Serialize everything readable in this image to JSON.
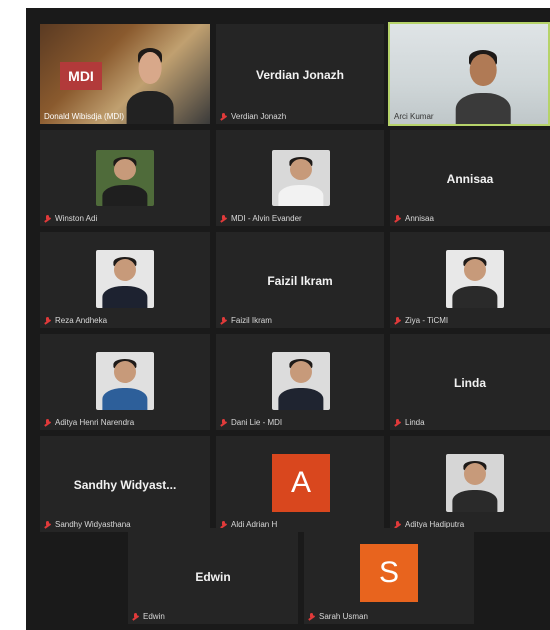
{
  "participants": [
    {
      "label": "Donald Wibisdja (MDI)",
      "kind": "video"
    },
    {
      "label": "Verdian Jonazh",
      "name_card": "Verdian Jonazh",
      "kind": "name"
    },
    {
      "label": "Arci Kumar",
      "kind": "video",
      "active_speaker": true
    },
    {
      "label": "Winston Adi",
      "kind": "photo"
    },
    {
      "label": "MDI - Alvin Evander",
      "kind": "photo"
    },
    {
      "label": "Annisaa",
      "name_card": "Annisaa",
      "kind": "name"
    },
    {
      "label": "Reza Andheka",
      "kind": "photo"
    },
    {
      "label": "Faizil Ikram",
      "name_card": "Faizil Ikram",
      "kind": "name"
    },
    {
      "label": "Ziya - TiCMI",
      "kind": "photo"
    },
    {
      "label": "Aditya Henri Narendra",
      "kind": "photo"
    },
    {
      "label": "Dani Lie - MDI",
      "kind": "photo"
    },
    {
      "label": "Linda",
      "name_card": "Linda",
      "kind": "name"
    },
    {
      "label": "Sandhy Widyasthana",
      "name_card": "Sandhy Widyast...",
      "kind": "name"
    },
    {
      "label": "Aldi Adrian H",
      "avatar_letter": "A",
      "avatar_color": "#d9471e",
      "kind": "letter"
    },
    {
      "label": "Aditya Hadiputra",
      "kind": "photo"
    },
    {
      "label": "Edwin",
      "name_card": "Edwin",
      "kind": "name"
    },
    {
      "label": "Sarah Usman",
      "avatar_letter": "S",
      "avatar_color": "#e8641e",
      "kind": "letter"
    }
  ],
  "colors": {
    "active_border": "#b6d36a",
    "muted_mic": "#e03a3a",
    "tile_bg": "#252525"
  },
  "icons": {
    "muted": "mic-muted-icon"
  },
  "video_overlays": {
    "logo_text": "MDI"
  }
}
